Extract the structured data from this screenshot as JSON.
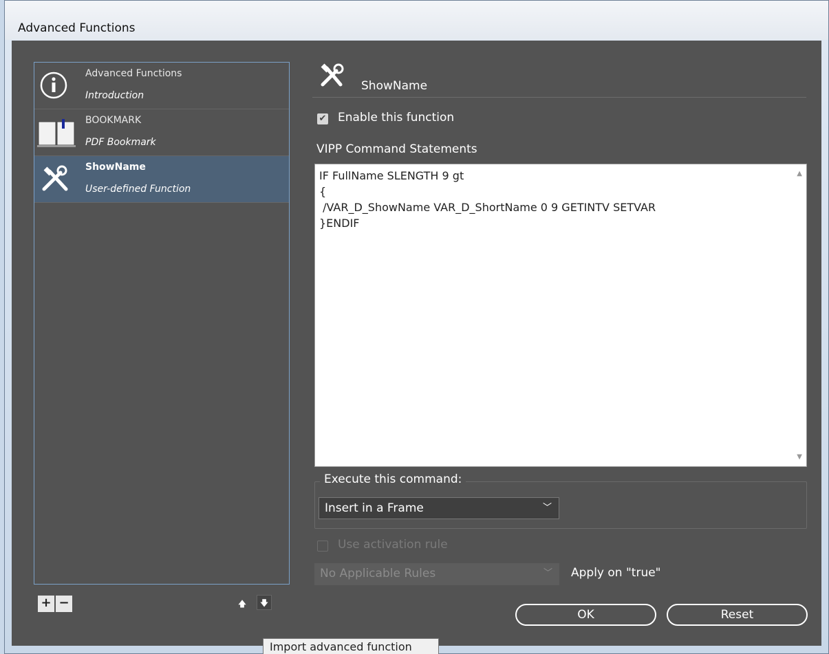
{
  "window": {
    "title": "Advanced Functions"
  },
  "functions": [
    {
      "name": "Advanced Functions",
      "description": "Introduction",
      "icon": "info-icon"
    },
    {
      "name": "BOOKMARK",
      "description": "PDF Bookmark",
      "icon": "book-icon"
    },
    {
      "name": "ShowName",
      "description": "User-defined Function",
      "icon": "tools-icon",
      "selected": true
    }
  ],
  "list_controls": {
    "add": "+",
    "remove": "−",
    "up": "🡅",
    "down": "🡇"
  },
  "detail": {
    "name": "ShowName",
    "enable_label": "Enable this function",
    "enabled": true,
    "commands_label": "VIPP Command Statements",
    "commands_text": "IF FullName SLENGTH 9 gt\n{\n /VAR_D_ShowName VAR_D_ShortName 0 9 GETINTV SETVAR\n}ENDIF",
    "execute_label": "Execute this command:",
    "execute_value": "Insert in a Frame",
    "activation_label": "Use activation rule",
    "activation_enabled": false,
    "rules_value": "No Applicable Rules",
    "apply_label": "Apply on \"true\""
  },
  "buttons": {
    "ok": "OK",
    "reset": "Reset"
  },
  "tooltip": "Import advanced function",
  "colors": {
    "panel": "#535353",
    "selection": "#4d6278",
    "accent_border": "#7ba1c8"
  }
}
